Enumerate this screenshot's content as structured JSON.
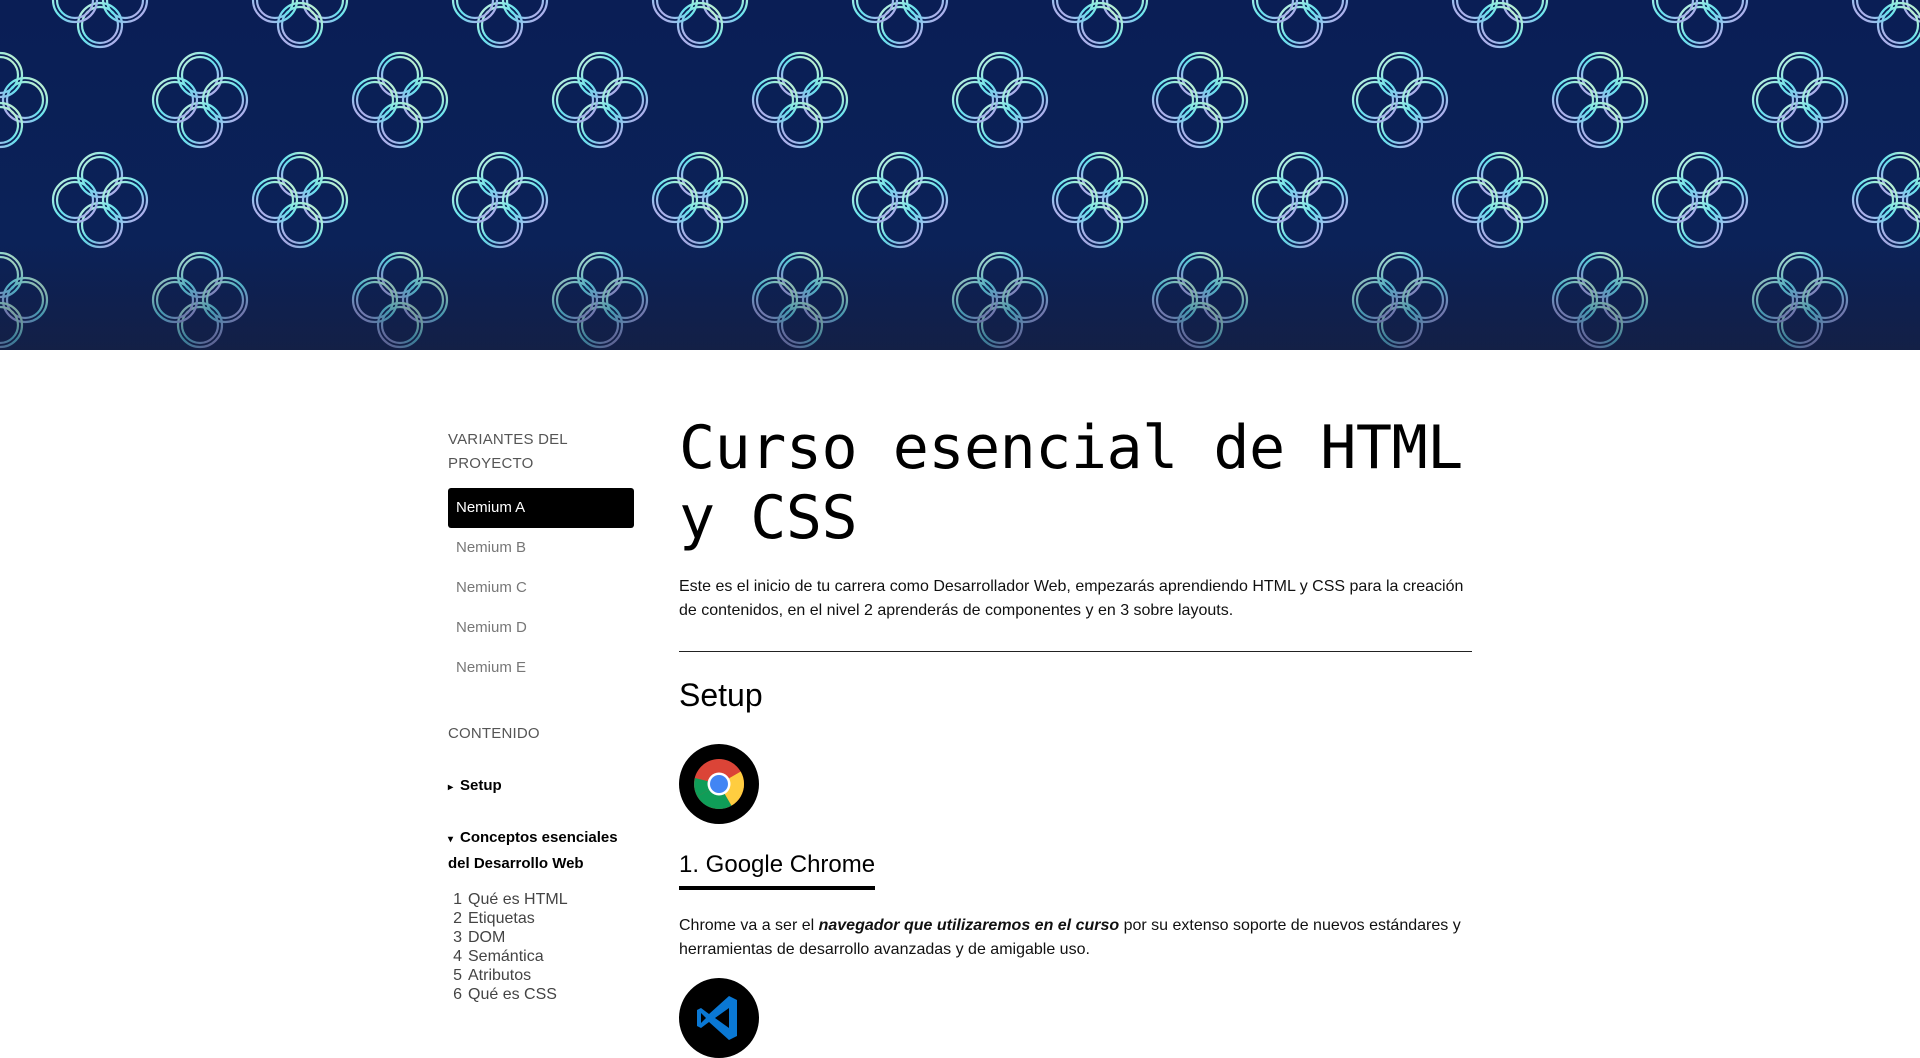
{
  "sidebar": {
    "variants_heading": "VARIANTES DEL PROYECTO",
    "variants": [
      {
        "label": "Nemium A",
        "active": true
      },
      {
        "label": "Nemium B",
        "active": false
      },
      {
        "label": "Nemium C",
        "active": false
      },
      {
        "label": "Nemium D",
        "active": false
      },
      {
        "label": "Nemium E",
        "active": false
      }
    ],
    "content_heading": "CONTENIDO",
    "sections": [
      {
        "marker": "▸",
        "label": "Setup",
        "expanded": false
      },
      {
        "marker": "▾",
        "label": "Conceptos esenciales del Desarrollo Web",
        "expanded": true
      }
    ],
    "lessons": [
      {
        "num": "1",
        "label": "Qué es HTML"
      },
      {
        "num": "2",
        "label": "Etiquetas"
      },
      {
        "num": "3",
        "label": "DOM"
      },
      {
        "num": "4",
        "label": "Semántica"
      },
      {
        "num": "5",
        "label": "Atributos"
      },
      {
        "num": "6",
        "label": "Qué es CSS"
      }
    ]
  },
  "main": {
    "title": "Curso esencial de HTML y CSS",
    "intro": "Este es el inicio de tu carrera como Desarrollador Web, empezarás aprendiendo HTML y CSS para la creación de contenidos, en el nivel 2 aprenderás de componentes y en 3 sobre layouts.",
    "section_title": "Setup",
    "tools": [
      {
        "icon": "chrome-icon",
        "title": "1. Google Chrome",
        "desc_before": "Chrome va a ser el ",
        "desc_emphasis": "navegador que utilizaremos en el curso",
        "desc_after": " por su extenso soporte de nuevos estándares y herramientas de desarrollo avanzadas y de amigable uso."
      },
      {
        "icon": "vscode-icon"
      }
    ]
  },
  "colors": {
    "hero_bg": "#0a1e55",
    "pattern_cyan": "#66e3ee",
    "pattern_violet": "#c79be8",
    "pattern_mint": "#c9f0d6",
    "active_variant_bg": "#000000"
  }
}
